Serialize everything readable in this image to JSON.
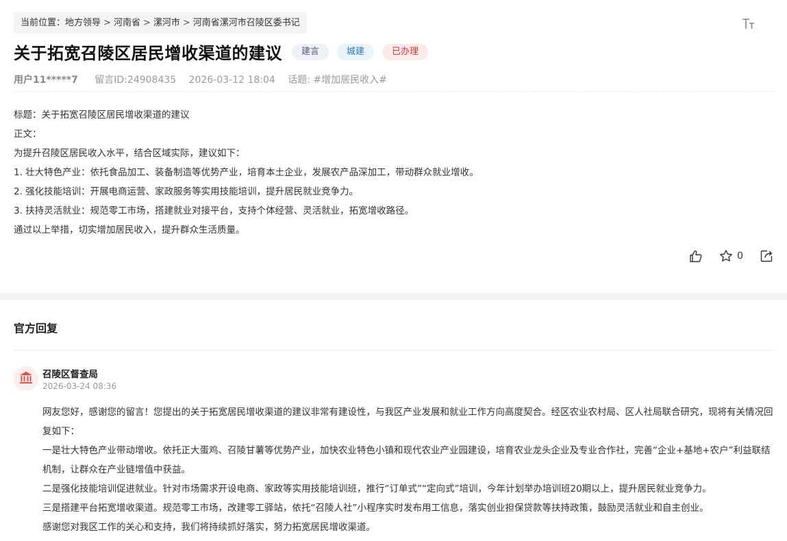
{
  "breadcrumb": {
    "prefix": "当前位置：",
    "items": [
      "地方领导",
      "河南省",
      "漯河市",
      "河南省漯河市召陵区委书记"
    ],
    "separator": ">"
  },
  "post": {
    "title": "关于拓宽召陵区居民增收渠道的建议",
    "tags": [
      "建言",
      "城建",
      "已办理"
    ],
    "user": "用户11*****7",
    "message_id": "留言ID:24908435",
    "datetime": "2026-03-12 18:04",
    "topic_label": "话题:",
    "topic": "#增加居民收入#",
    "content": [
      "标题：关于拓宽召陵区居民增收渠道的建议",
      "正文：",
      "为提升召陵区居民收入水平，结合区域实际，建议如下：",
      "1. 壮大特色产业：依托食品加工、装备制造等优势产业，培育本土企业，发展农产品深加工，带动群众就业增收。",
      "2. 强化技能培训：开展电商运营、家政服务等实用技能培训，提升居民就业竞争力。",
      "3. 扶持灵活就业：规范零工市场，搭建就业对接平台，支持个体经营、灵活就业，拓宽增收路径。",
      "通过以上举措，切实增加居民收入，提升群众生活质量。"
    ],
    "favorite_count": "0"
  },
  "reply": {
    "heading": "官方回复",
    "org_name": "召陵区督查局",
    "datetime": "2026-03-24 08:36",
    "paragraphs": [
      "网友您好，感谢您的留言！您提出的关于拓宽居民增收渠道的建议非常有建设性，与我区产业发展和就业工作方向高度契合。经区农业农村局、区人社局联合研究，现将有关情况回复如下：",
      "一是壮大特色产业带动增收。依托正大蛋鸡、召陵甘薯等优势产业，加快农业特色小镇和现代农业产业园建设，培育农业龙头企业及专业合作社，完善“企业+基地+农户”利益联结机制，让群众在产业链增值中获益。",
      "二是强化技能培训促进就业。针对市场需求开设电商、家政等实用技能培训班，推行“订单式”“定向式”培训，今年计划举办培训班20期以上，提升居民就业竞争力。",
      "三是搭建平台拓宽增收渠道。规范零工市场，改建零工驿站，依托“召陵人社”小程序实时发布用工信息，落实创业担保贷款等扶持政策，鼓励灵活就业和自主创业。",
      "感谢您对我区工作的关心和支持，我们将持续抓好落实，努力拓宽居民增收渠道。"
    ]
  },
  "icons": {
    "font_size": "font-size-icon",
    "like": "thumbs-up-icon",
    "favorite": "star-icon",
    "share": "share-icon",
    "org": "government-building-icon"
  },
  "colors": {
    "done_tag": "#d9383a",
    "city_tag": "#2c7ab3",
    "advice_tag": "#51627d",
    "org_icon": "#e0524e"
  }
}
